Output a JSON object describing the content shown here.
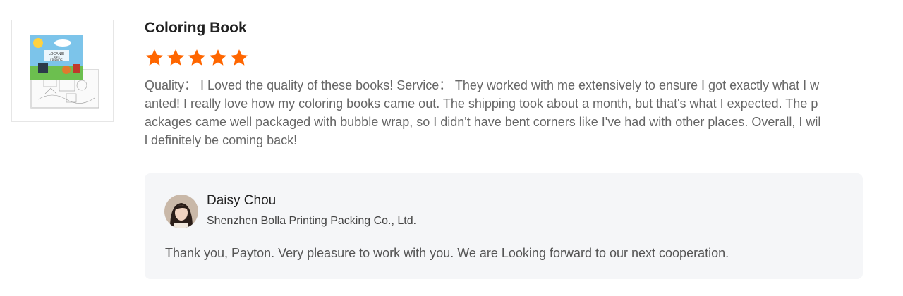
{
  "product": {
    "image_alt": "Coloring book product photo",
    "cover_lines": [
      "LOGANIE",
      "AND",
      "FRIENDS"
    ]
  },
  "review": {
    "title": "Coloring Book",
    "rating": 5,
    "rating_max": 5,
    "star_color": "#ff6600",
    "text": "Quality：  I Loved the quality of these books! Service：  They worked with me extensively to ensure I got exactly what I wanted! I really love how my coloring books came out. The shipping took about a month, but that's what I expected. The packages came well packaged with bubble wrap, so I didn't have bent corners like I've had with other places. Overall, I will definitely be coming back!"
  },
  "reply": {
    "name": "Daisy Chou",
    "company": "Shenzhen Bolla Printing Packing Co., Ltd.",
    "text": "Thank you, Payton. Very pleasure to work with you. We are Looking forward to our next cooperation."
  }
}
